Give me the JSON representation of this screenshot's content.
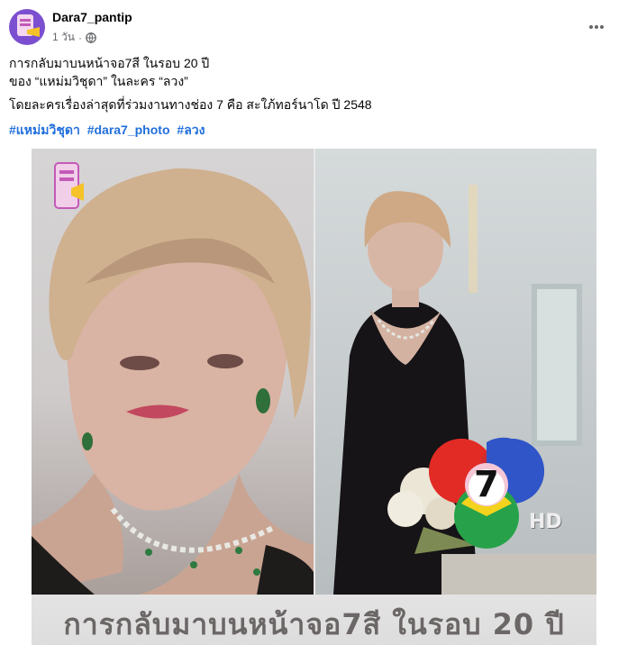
{
  "post": {
    "author": "Dara7_pantip",
    "time": "1 วัน",
    "separator": "·",
    "visibility_icon": "globe-icon",
    "more_icon": "more-options-icon",
    "line1": "การกลับมาบนหน้าจอ7สี ในรอบ 20 ปี",
    "line2": "ของ “แหม่มวิชุดา” ในละคร “ลวง”",
    "line3": "โดยละครเรื่องล่าสุดที่ร่วมงานทางช่อง 7 คือ สะใภ้ทอร์นาโด ปี 2548",
    "hashtags": [
      "#แหม่มวิชุดา",
      "#dara7_photo",
      "#ลวง"
    ]
  },
  "photo": {
    "caption": "การกลับมาบนหน้าจอ7สี ในรอบ 20 ปี",
    "logo_digit": "7",
    "logo_badge": "HD",
    "channel_logo": "channel-7-logo",
    "watermark": "dara7-pantip-watermark"
  },
  "colors": {
    "author": "#050505",
    "meta": "#65676b",
    "hashtag": "#216fdb",
    "caption": "#6b6766"
  }
}
